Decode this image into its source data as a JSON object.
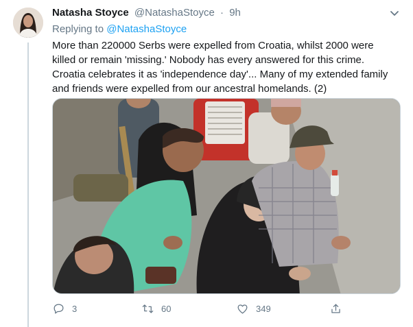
{
  "tweet": {
    "display_name": "Natasha Stoyce",
    "handle": "@NatashaStoyce",
    "separator": "·",
    "time": "9h",
    "replying_to_prefix": "Replying to",
    "replying_to_handle": "@NatashaStoyce",
    "text": "More than 220000 Serbs were expelled from Croatia, whilst 2000 were\nkilled or remain 'missing.' Nobody has every answered for this crime.\nCroatia celebrates it as 'independence day'... Many of my extended family\nand friends were expelled from our ancestral homelands. (2)"
  },
  "actions": {
    "replies": "3",
    "retweets": "60",
    "likes": "349"
  },
  "icons": {
    "caret": "chevron-down-icon",
    "reply": "reply-icon",
    "retweet": "retweet-icon",
    "like": "heart-icon",
    "share": "share-icon"
  },
  "colors": {
    "link": "#1da1f2",
    "secondary_text": "#657786",
    "thread_line": "#ccd6dd"
  }
}
